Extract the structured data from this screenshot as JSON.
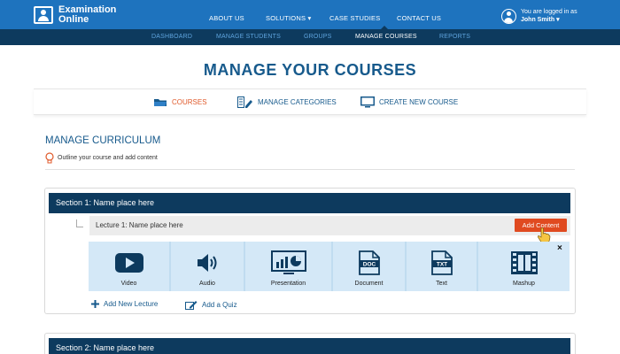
{
  "brand": {
    "line1": "Examination",
    "line2": "Online"
  },
  "top_nav": [
    "ABOUT US",
    "SOLUTIONS",
    "CASE STUDIES",
    "CONTACT US"
  ],
  "user": {
    "status": "You are logged in as",
    "name": "John Smith"
  },
  "sub_nav": {
    "items": [
      "DASHBOARD",
      "MANAGE STUDENTS",
      "GROUPS",
      "MANAGE COURSES",
      "REPORTS"
    ],
    "active": "MANAGE COURSES"
  },
  "page_title": "MANAGE YOUR COURSES",
  "tabs": [
    {
      "label": "COURSES",
      "icon": "folder-icon",
      "active": true
    },
    {
      "label": "MANAGE CATEGORIES",
      "icon": "edit-list-icon",
      "active": false
    },
    {
      "label": "CREATE NEW COURSE",
      "icon": "monitor-icon",
      "active": false
    }
  ],
  "curriculum": {
    "title": "MANAGE CURRICULUM",
    "hint": "Outline your course and add content"
  },
  "sections": [
    {
      "title": "Section 1: Name place here",
      "lecture": "Lecture 1: Name place here",
      "add_content": "Add Content",
      "content_types": [
        {
          "label": "Video",
          "icon": "video-play-icon"
        },
        {
          "label": "Audio",
          "icon": "speaker-icon"
        },
        {
          "label": "Presentation",
          "icon": "presentation-icon"
        },
        {
          "label": "Document",
          "icon": "doc-file-icon"
        },
        {
          "label": "Text",
          "icon": "txt-file-icon"
        },
        {
          "label": "Mashup",
          "icon": "film-strip-icon"
        }
      ],
      "close": "×",
      "add_lecture": "Add New Lecture",
      "add_quiz": "Add a Quiz"
    },
    {
      "title": "Section 2: Name place here"
    }
  ],
  "colors": {
    "primary": "#1e73be",
    "dark": "#0d3a5e",
    "accent": "#e05a2b",
    "button": "#e04a20",
    "panel": "#c8e1f3"
  }
}
